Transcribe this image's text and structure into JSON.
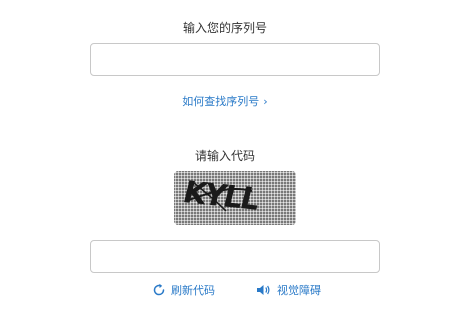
{
  "serial_section": {
    "heading": "输入您的序列号",
    "input_value": "",
    "input_placeholder": "",
    "help_link": "如何查找序列号",
    "help_link_chevron": "›"
  },
  "code_section": {
    "heading": "请输入代码",
    "captcha_text": "KYLL",
    "input_value": "",
    "input_placeholder": ""
  },
  "actions": {
    "refresh_label": "刷新代码",
    "refresh_icon": "refresh-icon",
    "audio_label": "视觉障碍",
    "audio_icon": "speaker-icon"
  },
  "colors": {
    "link": "#2a7ac8",
    "text": "#333333",
    "border": "#c8c8c8",
    "captcha_bg": "#9a9a9a"
  }
}
